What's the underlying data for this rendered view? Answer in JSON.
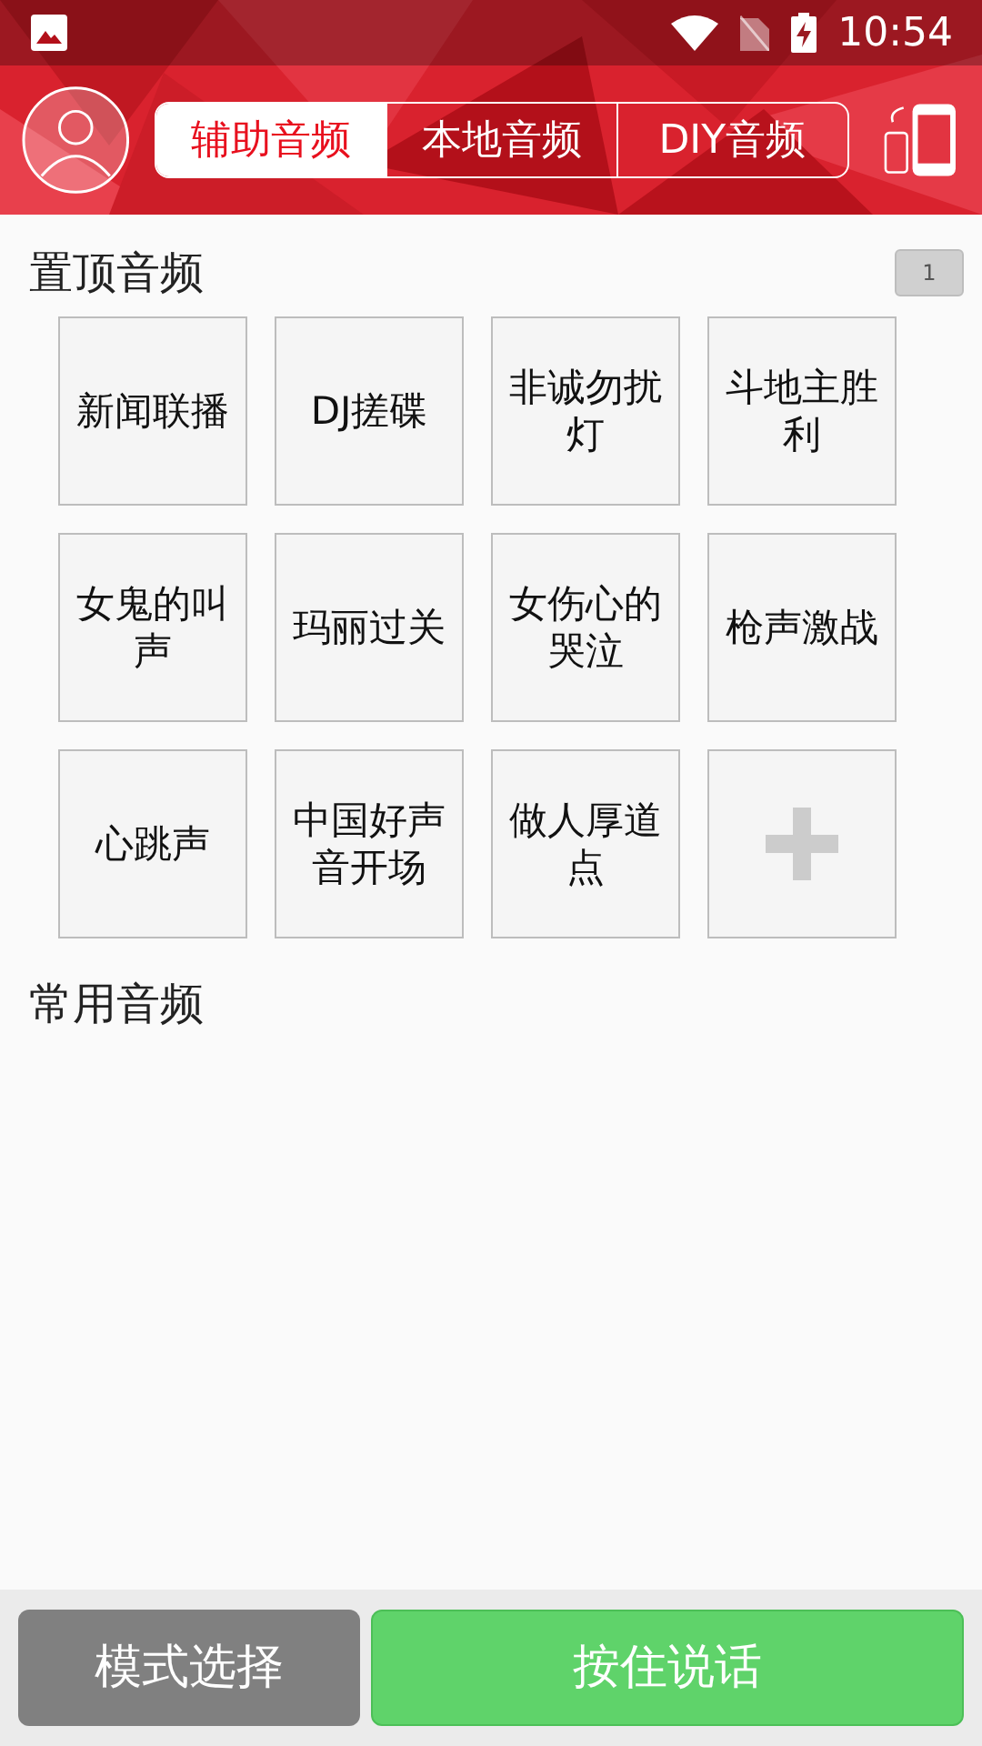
{
  "status_bar": {
    "time": "10:54"
  },
  "tabs": [
    {
      "label": "辅助音频",
      "selected": true
    },
    {
      "label": "本地音频",
      "selected": false
    },
    {
      "label": "DIY音频",
      "selected": false
    }
  ],
  "pinned": {
    "title": "置顶音频",
    "badge": "1",
    "items": [
      {
        "kind": "audio",
        "label": "新闻联播"
      },
      {
        "kind": "audio",
        "label": "DJ搓碟"
      },
      {
        "kind": "audio",
        "label": "非诚勿扰灯"
      },
      {
        "kind": "audio",
        "label": "斗地主胜利"
      },
      {
        "kind": "audio",
        "label": "女鬼的叫声"
      },
      {
        "kind": "audio",
        "label": "玛丽过关"
      },
      {
        "kind": "audio",
        "label": "女伤心的哭泣"
      },
      {
        "kind": "audio",
        "label": "枪声激战"
      },
      {
        "kind": "audio",
        "label": "心跳声"
      },
      {
        "kind": "audio",
        "label": "中国好声音开场"
      },
      {
        "kind": "audio",
        "label": "做人厚道点"
      },
      {
        "kind": "add"
      }
    ]
  },
  "common": {
    "title": "常用音频"
  },
  "buttons": [
    {
      "kind": "secondary",
      "label": "模式选择"
    },
    {
      "kind": "primary",
      "label": "按住说话"
    }
  ]
}
